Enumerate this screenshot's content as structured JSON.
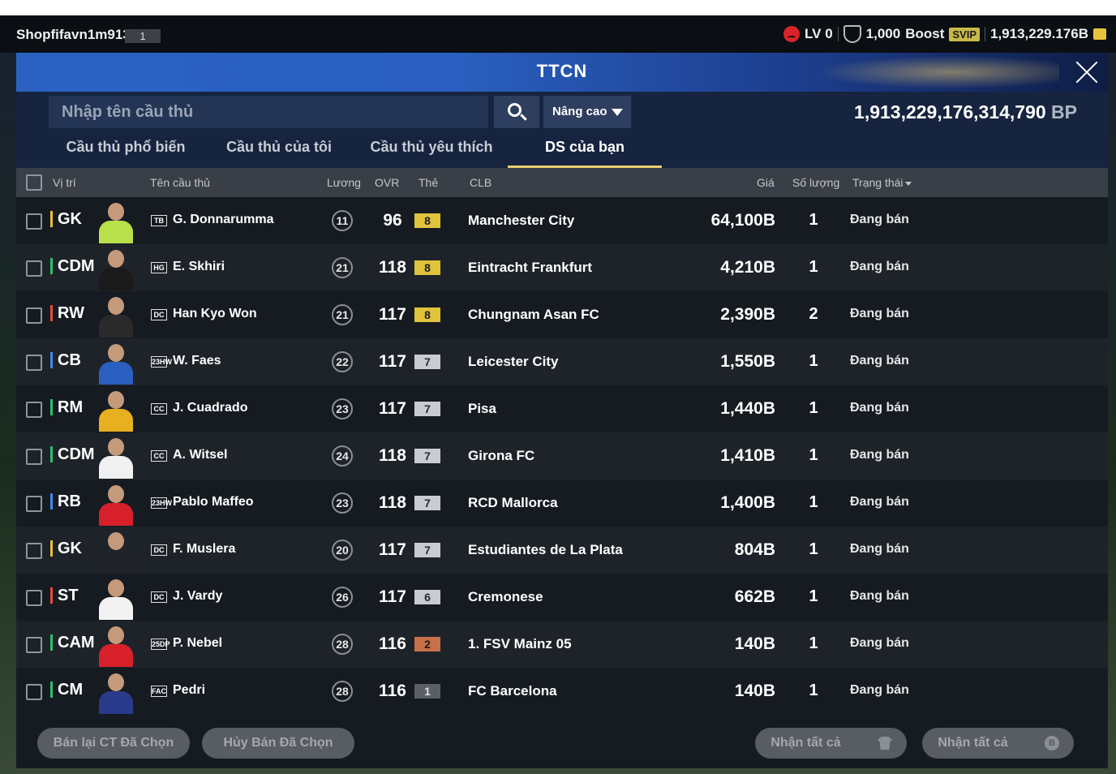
{
  "topbar": {
    "username": "Shopfifavn1m913",
    "user_badge": "1",
    "level": "LV 0",
    "coins": "1,000",
    "boost_label": "Boost",
    "svip": "SVIP",
    "bp_short": "1,913,229.176B"
  },
  "window": {
    "title": "TTCN"
  },
  "search": {
    "placeholder": "Nhập tên cầu thủ",
    "advanced_label": "Nâng cao",
    "bp_value": "1,913,229,176,314,790",
    "bp_unit": "BP"
  },
  "tabs": [
    {
      "label": "Cầu thủ phổ biến"
    },
    {
      "label": "Cầu thủ của tôi"
    },
    {
      "label": "Cầu thủ yêu thích"
    },
    {
      "label": "DS của bạn"
    }
  ],
  "columns": {
    "position": "Vị trí",
    "name": "Tên cầu thủ",
    "salary": "Lương",
    "ovr": "OVR",
    "card": "Thẻ",
    "club": "CLB",
    "price": "Giá",
    "quantity": "Số lượng",
    "status": "Trạng thái"
  },
  "rows": [
    {
      "pos": "GK",
      "season": "TB",
      "name": "G. Donnarumma",
      "salary": "11",
      "ovr": "96",
      "grade": "8",
      "club": "Manchester City",
      "price": "64,100B",
      "qty": "1",
      "status": "Đang bán"
    },
    {
      "pos": "CDM",
      "season": "HG",
      "name": "E. Skhiri",
      "salary": "21",
      "ovr": "118",
      "grade": "8",
      "club": "Eintracht Frankfurt",
      "price": "4,210B",
      "qty": "1",
      "status": "Đang bán"
    },
    {
      "pos": "RW",
      "season": "DC",
      "name": "Han Kyo Won",
      "salary": "21",
      "ovr": "117",
      "grade": "8",
      "club": "Chungnam Asan FC",
      "price": "2,390B",
      "qty": "2",
      "status": "Đang bán"
    },
    {
      "pos": "CB",
      "season": "23HW",
      "name": "W. Faes",
      "salary": "22",
      "ovr": "117",
      "grade": "7",
      "club": "Leicester City",
      "price": "1,550B",
      "qty": "1",
      "status": "Đang bán"
    },
    {
      "pos": "RM",
      "season": "CC",
      "name": "J. Cuadrado",
      "salary": "23",
      "ovr": "117",
      "grade": "7",
      "club": "Pisa",
      "price": "1,440B",
      "qty": "1",
      "status": "Đang bán"
    },
    {
      "pos": "CDM",
      "season": "CC",
      "name": "A. Witsel",
      "salary": "24",
      "ovr": "118",
      "grade": "7",
      "club": "Girona FC",
      "price": "1,410B",
      "qty": "1",
      "status": "Đang bán"
    },
    {
      "pos": "RB",
      "season": "23HW",
      "name": "Pablo Maffeo",
      "salary": "23",
      "ovr": "118",
      "grade": "7",
      "club": "RCD Mallorca",
      "price": "1,400B",
      "qty": "1",
      "status": "Đang bán"
    },
    {
      "pos": "GK",
      "season": "DC",
      "name": "F. Muslera",
      "salary": "20",
      "ovr": "117",
      "grade": "7",
      "club": "Estudiantes de La Plata",
      "price": "804B",
      "qty": "1",
      "status": "Đang bán"
    },
    {
      "pos": "ST",
      "season": "DC",
      "name": "J. Vardy",
      "salary": "26",
      "ovr": "117",
      "grade": "6",
      "club": "Cremonese",
      "price": "662B",
      "qty": "1",
      "status": "Đang bán"
    },
    {
      "pos": "CAM",
      "season": "25DP",
      "name": "P. Nebel",
      "salary": "28",
      "ovr": "116",
      "grade": "2",
      "club": "1. FSV Mainz 05",
      "price": "140B",
      "qty": "1",
      "status": "Đang bán"
    },
    {
      "pos": "CM",
      "season": "FAC",
      "name": "Pedri",
      "salary": "28",
      "ovr": "116",
      "grade": "1",
      "club": "FC Barcelona",
      "price": "140B",
      "qty": "1",
      "status": "Đang bán"
    }
  ],
  "footer": {
    "resell_label": "Bán lại CT Đã Chọn",
    "cancel_label": "Hủy Bán Đã Chọn",
    "claim_all_label": "Nhận tất cả",
    "claim_all_bp_label": "Nhận tất cả"
  },
  "colors": {
    "gk": "#e8c13a",
    "def": "#3a8be8",
    "mid": "#2ec06a",
    "att": "#e84a3a",
    "grade_gold": "#e0c23c",
    "grade_silver": "#c8ccd2",
    "grade_bronze": "#c8704a"
  }
}
